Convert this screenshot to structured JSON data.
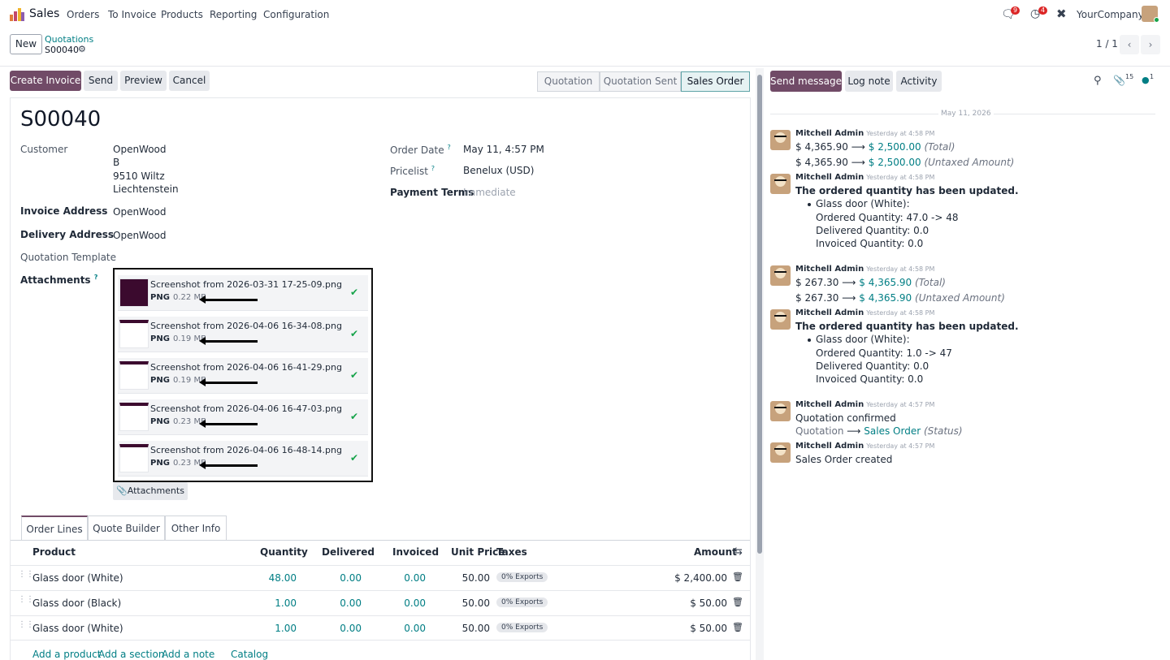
{
  "navbar": {
    "app_name": "Sales",
    "menu": [
      "Orders",
      "To Invoice",
      "Products",
      "Reporting",
      "Configuration"
    ],
    "messages_badge": "9",
    "activities_badge": "4",
    "company": "YourCompany"
  },
  "control_panel": {
    "new_label": "New",
    "breadcrumb_parent": "Quotations",
    "breadcrumb_current": "S00040",
    "pager": "1 / 1"
  },
  "actions": {
    "create_invoice": "Create Invoice",
    "send": "Send",
    "preview": "Preview",
    "cancel": "Cancel"
  },
  "statusbar": [
    "Quotation",
    "Quotation Sent",
    "Sales Order"
  ],
  "statusbar_active": "Sales Order",
  "form": {
    "title": "S00040",
    "customer_label": "Customer",
    "customer_name": "OpenWood",
    "customer_addr1": "B",
    "customer_addr2": "9510 Wiltz",
    "customer_addr3": "Liechtenstein",
    "invoice_address_label": "Invoice Address",
    "invoice_address": "OpenWood",
    "delivery_address_label": "Delivery Address",
    "delivery_address": "OpenWood",
    "quotation_template_label": "Quotation Template",
    "attachments_label": "Attachments",
    "order_date_label": "Order Date",
    "order_date": "May 11, 4:57 PM",
    "pricelist_label": "Pricelist",
    "pricelist": "Benelux (USD)",
    "payment_terms_label": "Payment Terms",
    "payment_terms": "Immediate",
    "help_mark": "?",
    "attachments_button": "Attachments"
  },
  "attachments": [
    {
      "name": "Screenshot from 2026-03-31 17-25-09.png",
      "type": "PNG",
      "size": "0.22 MB"
    },
    {
      "name": "Screenshot from 2026-04-06 16-34-08.png",
      "type": "PNG",
      "size": "0.19 MB"
    },
    {
      "name": "Screenshot from 2026-04-06 16-41-29.png",
      "type": "PNG",
      "size": "0.19 MB"
    },
    {
      "name": "Screenshot from 2026-04-06 16-47-03.png",
      "type": "PNG",
      "size": "0.23 MB"
    },
    {
      "name": "Screenshot from 2026-04-06 16-48-14.png",
      "type": "PNG",
      "size": "0.23 MB"
    }
  ],
  "tabs": [
    "Order Lines",
    "Quote Builder",
    "Other Info"
  ],
  "table": {
    "headers": {
      "product": "Product",
      "quantity": "Quantity",
      "delivered": "Delivered",
      "invoiced": "Invoiced",
      "unit_price": "Unit Price",
      "taxes": "Taxes",
      "amount": "Amount"
    },
    "rows": [
      {
        "product": "Glass door (White)",
        "quantity": "48.00",
        "delivered": "0.00",
        "invoiced": "0.00",
        "unit_price": "50.00",
        "tax": "0% Exports",
        "amount": "$ 2,400.00"
      },
      {
        "product": "Glass door (Black)",
        "quantity": "1.00",
        "delivered": "0.00",
        "invoiced": "0.00",
        "unit_price": "50.00",
        "tax": "0% Exports",
        "amount": "$ 50.00"
      },
      {
        "product": "Glass door (White)",
        "quantity": "1.00",
        "delivered": "0.00",
        "invoiced": "0.00",
        "unit_price": "50.00",
        "tax": "0% Exports",
        "amount": "$ 50.00"
      }
    ],
    "add_links": [
      "Add a product",
      "Add a section",
      "Add a note",
      "Catalog"
    ]
  },
  "chatter": {
    "send_message": "Send message",
    "log_note": "Log note",
    "activity": "Activity",
    "attachments_count": "15",
    "followers_count": "1",
    "date_separator": "May 11, 2026",
    "author": "Mitchell Admin",
    "messages": [
      {
        "time": "Yesterday at 4:58 PM",
        "lines": [
          {
            "old": "$ 4,365.90",
            "new": "$ 2,500.00",
            "field": "(Total)"
          },
          {
            "old": "$ 4,365.90",
            "new": "$ 2,500.00",
            "field": "(Untaxed Amount)"
          }
        ]
      },
      {
        "time": "Yesterday at 4:58 PM",
        "heading": "The ordered quantity has been updated.",
        "item": "Glass door (White):",
        "details": [
          "Ordered Quantity: 47.0 -> 48",
          "Delivered Quantity: 0.0",
          "Invoiced Quantity: 0.0"
        ]
      },
      {
        "time": "Yesterday at 4:58 PM",
        "lines": [
          {
            "old": "$ 267.30",
            "new": "$ 4,365.90",
            "field": "(Total)"
          },
          {
            "old": "$ 267.30",
            "new": "$ 4,365.90",
            "field": "(Untaxed Amount)"
          }
        ]
      },
      {
        "time": "Yesterday at 4:58 PM",
        "heading": "The ordered quantity has been updated.",
        "item": "Glass door (White):",
        "details": [
          "Ordered Quantity: 1.0 -> 47",
          "Delivered Quantity: 0.0",
          "Invoiced Quantity: 0.0"
        ]
      },
      {
        "time": "Yesterday at 4:57 PM",
        "text": "Quotation confirmed",
        "lines": [
          {
            "old": "Quotation",
            "new": "Sales Order",
            "field": "(Status)"
          }
        ]
      },
      {
        "time": "Yesterday at 4:57 PM",
        "text": "Sales Order created"
      }
    ]
  },
  "colors": {
    "brand": "#714b67",
    "link": "#017e84",
    "badge": "#dc2626"
  }
}
